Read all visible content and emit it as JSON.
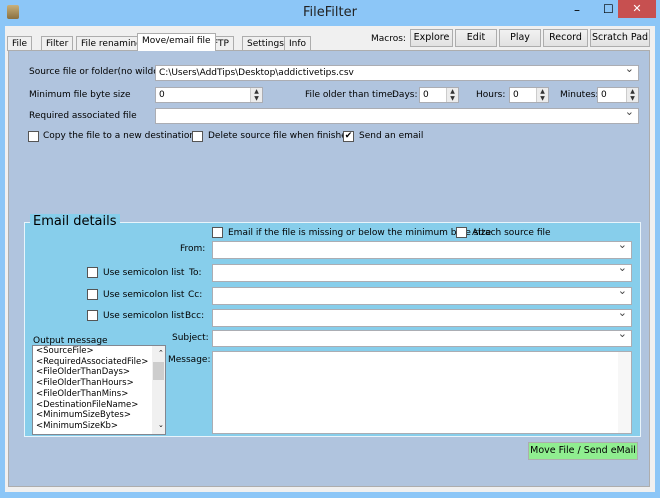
{
  "window": {
    "title": "FileFilter",
    "minimize": "–",
    "maximize": "☐",
    "close": "✕",
    "close_color": "#c75050"
  },
  "tabs": [
    {
      "label": "File"
    },
    {
      "label": "Filter"
    },
    {
      "label": "File renaming"
    },
    {
      "label": "Move/email file",
      "active": true
    },
    {
      "label": "FTP"
    },
    {
      "label": "Settings"
    },
    {
      "label": "Info"
    }
  ],
  "macros": {
    "label": "Macros:",
    "buttons": [
      "Explore",
      "Edit",
      "Play",
      "Record",
      "Scratch Pad"
    ]
  },
  "form": {
    "source_label": "Source file or folder(no wildcard)",
    "source_value": "C:\\Users\\AddTips\\Desktop\\addictivetips.csv",
    "min_size_label": "Minimum file byte size",
    "min_size_value": "0",
    "older_label": "File older than time:",
    "days_label": "Days:",
    "days_value": "0",
    "hours_label": "Hours:",
    "hours_value": "0",
    "minutes_label": "Minutes:",
    "minutes_value": "0",
    "required_label": "Required associated file",
    "required_value": "",
    "copy_label": "Copy the file to a new destination",
    "copy_checked": false,
    "delete_label": "Delete source file when finished",
    "delete_checked": false,
    "send_label": "Send an email",
    "send_checked": true
  },
  "email": {
    "title": "Email details",
    "missing_label": "Email if the file is missing or below the minimum byte size",
    "attach_label": "Attach source file",
    "from_label": "From:",
    "to_label": "To:",
    "cc_label": "Cc:",
    "bcc_label": "Bcc:",
    "subject_label": "Subject:",
    "message_label": "Message:",
    "semicolon_label": "Use semicolon list",
    "output_label": "Output message",
    "output_items": [
      "<SourceFile>",
      "<RequiredAssociatedFile>",
      "<FileOlderThanDays>",
      "<FileOlderThanHours>",
      "<FileOlderThanMins>",
      "<DestinationFileName>",
      "<MinimumSizeBytes>",
      "<MinimumSizeKb>"
    ]
  },
  "action_button": "Move File / Send eMail",
  "colors": {
    "panel": "#b0c4de",
    "group": "#87ceeb",
    "action": "#90ee90"
  }
}
